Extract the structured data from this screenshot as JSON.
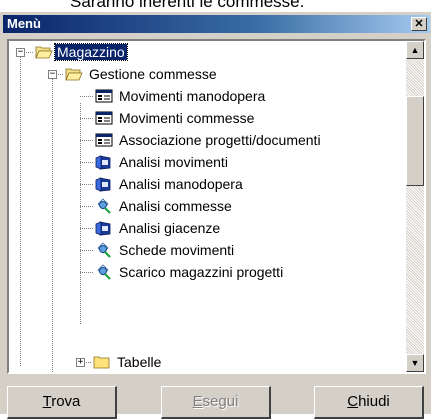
{
  "caption": {
    "text": "Saranno inerenti le commesse."
  },
  "window": {
    "title": "Menù",
    "close_glyph": "✕"
  },
  "tree": {
    "root": {
      "label": "Magazzino",
      "expander": "−",
      "icon": "open-folder-icon"
    },
    "group": {
      "label": "Gestione commesse",
      "expander": "−",
      "icon": "open-folder-icon"
    },
    "items": [
      {
        "label": "Movimenti manodopera",
        "icon": "form-icon"
      },
      {
        "label": "Movimenti commesse",
        "icon": "form-icon"
      },
      {
        "label": "Associazione progetti/documenti",
        "icon": "form-icon"
      },
      {
        "label": "Analisi movimenti",
        "icon": "analysis-icon"
      },
      {
        "label": "Analisi manodopera",
        "icon": "analysis-icon"
      },
      {
        "label": "Analisi commesse",
        "icon": "report-icon"
      },
      {
        "label": "Analisi giacenze",
        "icon": "analysis-icon"
      },
      {
        "label": "Schede movimenti",
        "icon": "report-icon"
      },
      {
        "label": "Scarico magazzini progetti",
        "icon": "report-icon"
      }
    ],
    "collapsed": {
      "label": "Tabelle",
      "expander": "+",
      "icon": "folder-icon"
    }
  },
  "scrollbar": {
    "up_glyph": "▲",
    "down_glyph": "▼"
  },
  "buttons": {
    "trova": {
      "mnemonic": "T",
      "rest": "rova"
    },
    "esegui": {
      "mnemonic": "E",
      "rest": "segui"
    },
    "chiudi": {
      "mnemonic": "C",
      "rest": "hiudi"
    }
  }
}
